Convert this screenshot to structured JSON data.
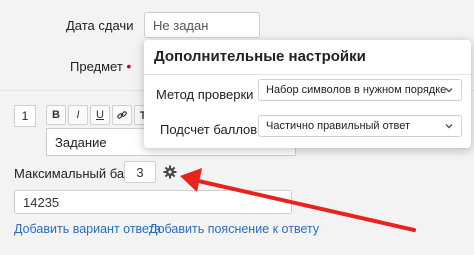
{
  "form": {
    "due_date_label": "Дата сдачи",
    "due_date_value": "Не задан",
    "subject_label": "Предмет",
    "question_number": "1",
    "toolbar": {
      "bold": "B",
      "italic": "I",
      "underline": "U",
      "link_icon": "link-icon",
      "clear_icon": "clear-format-icon"
    },
    "task_text": "Задание",
    "max_score_label": "Максимальный балл:",
    "max_score_value": "3",
    "answer_value": "14235",
    "add_answer_link": "Добавить вариант ответа",
    "add_explanation_link": "Добавить пояснение к ответу"
  },
  "modal": {
    "title": "Дополнительные настройки",
    "check_method_label": "Метод проверки",
    "check_method_value": "Набор символов в нужном порядке",
    "score_calc_label": "Подсчет баллов",
    "score_calc_value": "Частично правильный ответ"
  },
  "colors": {
    "link": "#2a6ebb",
    "required": "#d0021b",
    "arrow": "#e8231c"
  }
}
